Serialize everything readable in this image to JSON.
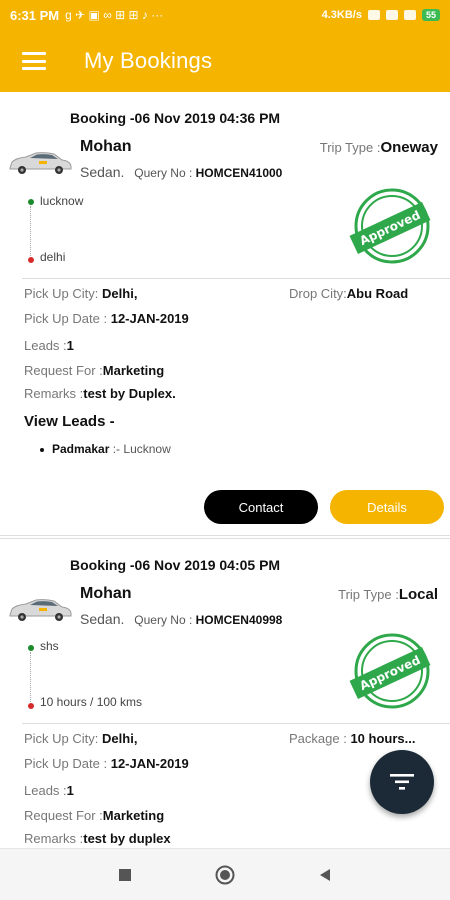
{
  "status_bar": {
    "time": "6:31 PM",
    "left_icons": "g ✈ ▣ ∞ ⊞ ⊞ ♪ ···",
    "speed": "4.3KB/s",
    "battery": "55"
  },
  "app_bar": {
    "title": "My Bookings"
  },
  "bookings": [
    {
      "header": "Booking -06 Nov 2019 04:36 PM",
      "name": "Mohan",
      "trip_type_label": "Trip Type :",
      "trip_type": "Oneway",
      "car_type": "Sedan.",
      "query_label": "Query No :",
      "query_no": "HOMCEN41000",
      "from": "lucknow",
      "to": "delhi",
      "stamp": "Approved",
      "pickup_city_label": "Pick Up City:",
      "pickup_city": "Delhi,",
      "drop_city_label": "Drop City:",
      "drop_city": "Abu Road",
      "pickup_date_label": "Pick Up Date :",
      "pickup_date": "12-JAN-2019",
      "leads_label": "Leads :",
      "leads": "1",
      "request_label": "Request For :",
      "request": "Marketing",
      "remarks_label": "Remarks :",
      "remarks": "test by Duplex.",
      "view_leads": "View Leads -",
      "lead_items": [
        {
          "name": "Padmakar",
          "sep": ":-",
          "city": "Lucknow"
        }
      ],
      "contact_label": "Contact",
      "details_label": "Details"
    },
    {
      "header": "Booking -06 Nov 2019 04:05 PM",
      "name": "Mohan",
      "trip_type_label": "Trip Type :",
      "trip_type": "Local",
      "car_type": "Sedan.",
      "query_label": "Query No :",
      "query_no": "HOMCEN40998",
      "from": "shs",
      "to": "10 hours / 100 kms",
      "stamp": "Approved",
      "pickup_city_label": "Pick Up City:",
      "pickup_city": "Delhi,",
      "package_label": "Package :",
      "package": "10 hours...",
      "pickup_date_label": "Pick Up Date :",
      "pickup_date": "12-JAN-2019",
      "leads_label": "Leads :",
      "leads": "1",
      "request_label": "Request For :",
      "request": "Marketing",
      "remarks_label": "Remarks :",
      "remarks": "test by duplex"
    }
  ],
  "icons": {
    "menu": "hamburger-menu-icon",
    "filter": "filter-icon",
    "nav_recent": "square-recents-icon",
    "nav_home": "circle-home-icon",
    "nav_back": "triangle-back-icon"
  },
  "colors": {
    "accent": "#F4B400",
    "contact_button": "#000000",
    "fab": "#1b2a36",
    "approved": "#2ea84a",
    "from_dot": "#1a8a2a",
    "to_dot": "#d62b2b"
  }
}
